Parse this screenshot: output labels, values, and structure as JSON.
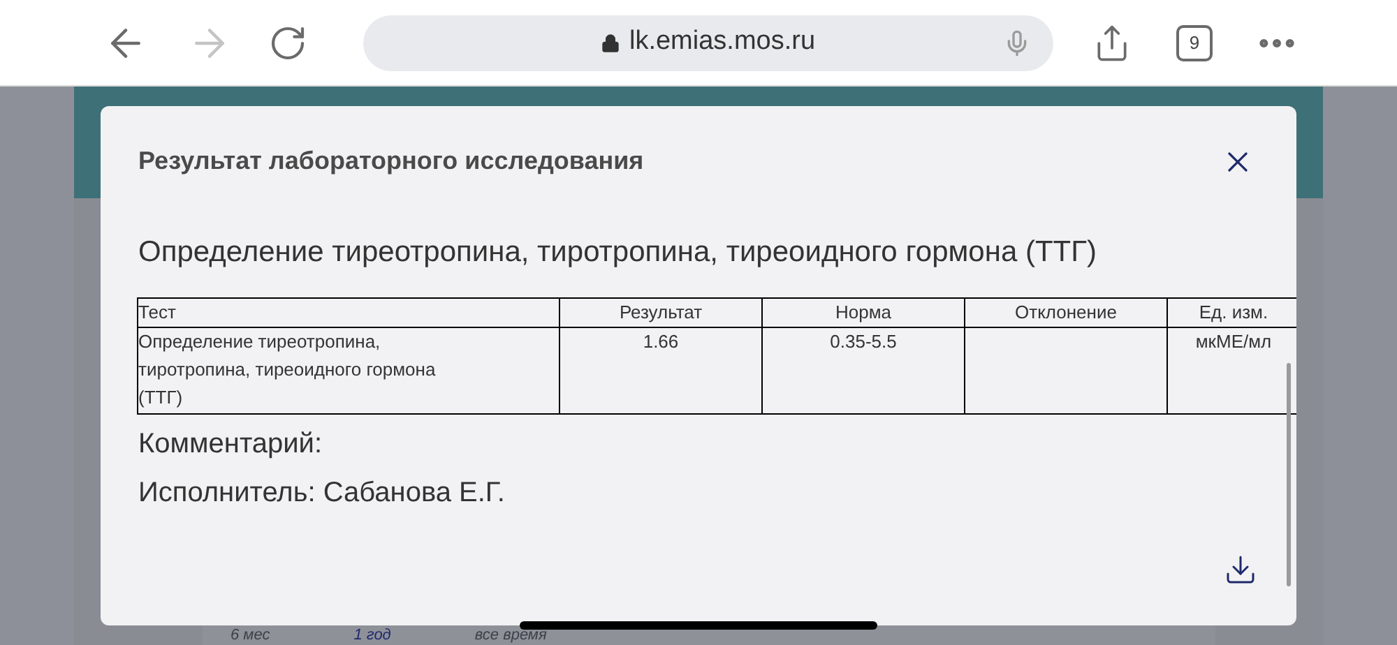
{
  "browser": {
    "url": "lk.emias.mos.ru",
    "tab_count": "9"
  },
  "modal": {
    "title": "Результат лабораторного исследования",
    "heading": "Определение тиреотропина, тиротропина, тиреоидного гормона (ТТГ)",
    "table": {
      "columns": [
        "Тест",
        "Результат",
        "Норма",
        "Отклонение",
        "Ед. изм."
      ],
      "rows": [
        [
          "Определение тиреотропина, тиротропина, тиреоидного гормона (ТТГ)",
          "1.66",
          "0.35-5.5",
          "",
          "мкМЕ/мл"
        ]
      ]
    },
    "comment": "Комментарий:",
    "performer": "Исполнитель: Сабанова Е.Г."
  },
  "period_tabs": [
    {
      "label": "6 мес",
      "selected": false
    },
    {
      "label": "1 год",
      "selected": true
    },
    {
      "label": "все время",
      "selected": false
    }
  ]
}
